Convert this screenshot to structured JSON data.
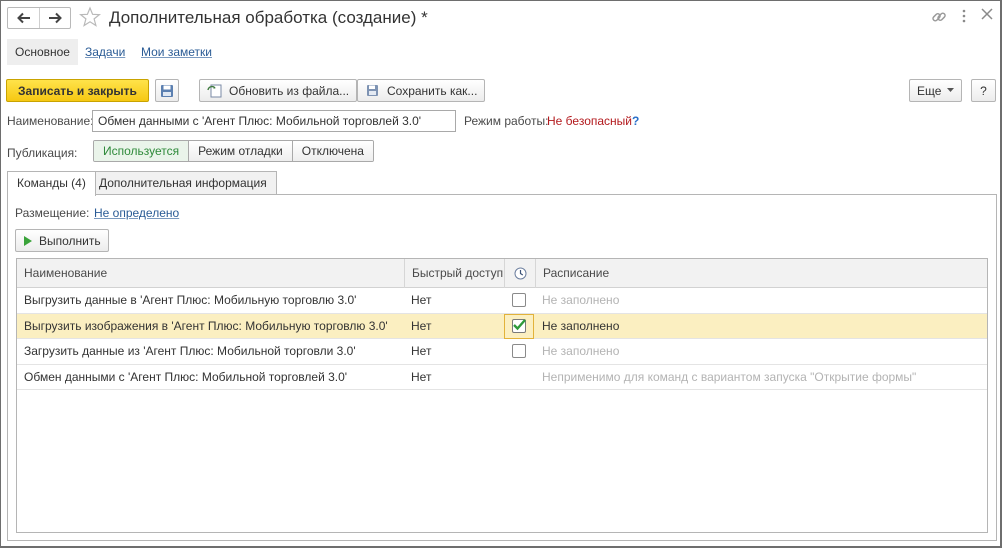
{
  "window": {
    "title": "Дополнительная обработка (создание) *"
  },
  "sections": {
    "active": "Основное",
    "links": [
      "Задачи",
      "Мои заметки"
    ]
  },
  "toolbar": {
    "save_close": "Записать и закрыть",
    "update_from_file": "Обновить из файла...",
    "save_as": "Сохранить как...",
    "more": "Еще",
    "help": "?"
  },
  "form": {
    "name_label": "Наименование:",
    "name_value": "Обмен данными с 'Агент Плюс: Мобильной торговлей 3.0'",
    "mode_label": "Режим работы:",
    "mode_value": "Не безопасный",
    "mode_help": "?",
    "publication_label": "Публикация:",
    "publication_options": [
      "Используется",
      "Режим отладки",
      "Отключена"
    ],
    "publication_selected": "Используется"
  },
  "tabs": [
    {
      "label": "Команды (4)",
      "active": true
    },
    {
      "label": "Дополнительная информация",
      "active": false
    }
  ],
  "commands": {
    "placement_label": "Размещение:",
    "placement_value": "Не определено",
    "run_button": "Выполнить",
    "columns": {
      "name": "Наименование",
      "quick": "Быстрый доступ",
      "schedule_icon": "clock-icon",
      "schedule": "Расписание"
    },
    "rows": [
      {
        "name": "Выгрузить данные в 'Агент Плюс: Мобильную торговлю 3.0'",
        "quick": "Нет",
        "checked": false,
        "schedule": "Не заполнено",
        "selected": false
      },
      {
        "name": "Выгрузить изображения в 'Агент Плюс: Мобильную торговлю 3.0'",
        "quick": "Нет",
        "checked": true,
        "schedule": "Не заполнено",
        "selected": true
      },
      {
        "name": "Загрузить данные из 'Агент Плюс: Мобильной торговли 3.0'",
        "quick": "Нет",
        "checked": false,
        "schedule": "Не заполнено",
        "selected": false
      },
      {
        "name": "Обмен данными с 'Агент Плюс: Мобильной торговлей 3.0'",
        "quick": "Нет",
        "checked": null,
        "schedule": "Неприменимо для команд с вариантом запуска \"Открытие формы\"",
        "selected": false
      }
    ]
  },
  "colors": {
    "primary_button": "#f6c812",
    "selected_row": "#fbefc1",
    "link": "#2a5b95",
    "danger_text": "#b3191d",
    "active_segment": "#2f8a3a"
  }
}
